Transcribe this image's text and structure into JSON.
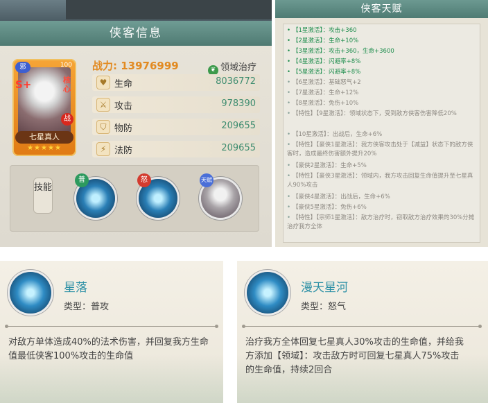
{
  "info": {
    "title": "侠客信息",
    "card": {
      "rank": "邪",
      "level": "100",
      "grade": "S+",
      "core": "核心",
      "battle": "战",
      "name": "七星真人",
      "stars": "★★★★★"
    },
    "power_label": "战力:",
    "power_value": "13976999",
    "domain_label": "领域治疗",
    "stats": [
      {
        "label": "生命",
        "value": "8036772",
        "icon": "heart-icon"
      },
      {
        "label": "攻击",
        "value": "978390",
        "icon": "attack-icon"
      },
      {
        "label": "物防",
        "value": "209655",
        "icon": "shield-icon"
      },
      {
        "label": "法防",
        "value": "209655",
        "icon": "magic-shield-icon"
      }
    ],
    "skills_label": "技能",
    "skill_tags": [
      "普",
      "怒",
      "天赋"
    ]
  },
  "talent": {
    "title": "侠客天赋",
    "items": [
      {
        "text": "【1星激活】：攻击+360",
        "active": true
      },
      {
        "text": "【2星激活】：生命+10%",
        "active": true
      },
      {
        "text": "【3星激活】：攻击+360，生命+3600",
        "active": true
      },
      {
        "text": "【4星激活】：闪避率+8%",
        "active": true
      },
      {
        "text": "【5星激活】：闪避率+8%",
        "active": true
      },
      {
        "text": "【6星激活】：基础怒气+2",
        "active": false
      },
      {
        "text": "【7星激活】：生命+12%",
        "active": false
      },
      {
        "text": "【8星激活】：免伤+10%",
        "active": false
      },
      {
        "text": "【特性】【9星激活】：领域状态下，受到敌方侠客伤害降低20%",
        "active": false
      },
      {
        "text": "【10星激活】：出战后，生命+6%",
        "active": false
      },
      {
        "text": "【特性】【豪侠1星激活】：我方侠客攻击处于【减益】状态下的敌方侠客时，造成最终伤害额外提升20%",
        "active": false
      },
      {
        "text": "【豪侠2星激活】：生命+5%",
        "active": false
      },
      {
        "text": "【特性】【豪侠3星激活】：领域内，我方攻击回复生命值提升至七星真人90%攻击",
        "active": false
      },
      {
        "text": "【豪侠4星激活】：出战后，生命+6%",
        "active": false
      },
      {
        "text": "【豪侠5星激活】：免伤+6%",
        "active": false
      },
      {
        "text": "【特性】【宗师1星激活】：敌方治疗时，窃取敌方治疗效果的30%分摊治疗我方全体",
        "active": false
      }
    ]
  },
  "skill_cards": [
    {
      "name": "星落",
      "type": "类型：普攻",
      "desc": "对敌方单体造成40%的法术伤害，并回复我方生命值最低侠客100%攻击的生命值"
    },
    {
      "name": "漫天星河",
      "type": "类型：怒气",
      "desc": "治疗我方全体回复七星真人30%攻击的生命值，并给我方添加【领域】：攻击敌方时可回复七星真人75%攻击的生命值，持续2回合"
    }
  ],
  "colors": {
    "accent": "#4f7a72",
    "power": "#e28a21",
    "stat_value": "#3d8c6f",
    "active_talent": "#1f8e4e",
    "skill_title": "#2b8fa5"
  }
}
